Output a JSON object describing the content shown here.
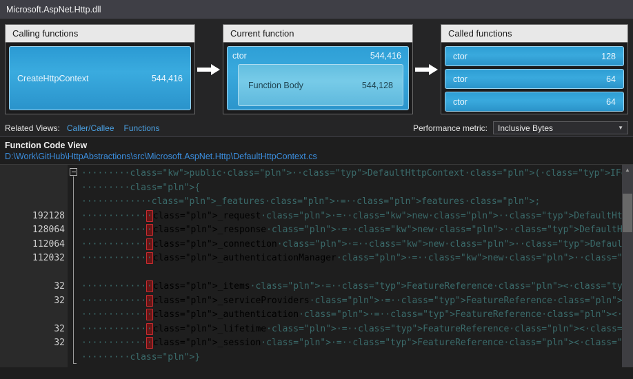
{
  "titlebar": {
    "text": "Microsoft.AspNet.Http.dll"
  },
  "callgraph": {
    "calling": {
      "header": "Calling functions",
      "items": [
        {
          "name": "CreateHttpContext",
          "value": "544,416"
        }
      ]
    },
    "current": {
      "header": "Current function",
      "name": "ctor",
      "value": "544,416",
      "body_name": "Function Body",
      "body_value": "544,128"
    },
    "called": {
      "header": "Called functions",
      "items": [
        {
          "name": "ctor",
          "value": "128"
        },
        {
          "name": "ctor",
          "value": "64"
        },
        {
          "name": "ctor",
          "value": "64"
        }
      ]
    }
  },
  "related_views": {
    "label": "Related Views:",
    "links": [
      "Caller/Callee",
      "Functions"
    ]
  },
  "performance_metric": {
    "label": "Performance metric:",
    "value": "Inclusive Bytes",
    "caret": "▼"
  },
  "function_code_view": {
    "title": "Function Code View",
    "path": "D:\\Work\\GitHub\\HttpAbstractions\\src\\Microsoft.AspNet.Http\\DefaultHttpContext.cs"
  },
  "code": {
    "gutter_counts": [
      "",
      "",
      "",
      "192128",
      "128064",
      "112064",
      "112032",
      "",
      "32",
      "32",
      "",
      "32",
      "32",
      ""
    ],
    "lines": [
      {
        "indent": 8,
        "text": "public DefaultHttpContext(IFeatureCollection features)",
        "highlight": false
      },
      {
        "indent": 8,
        "text": "{",
        "highlight": false
      },
      {
        "indent": 12,
        "text": "_features = features;",
        "highlight": false
      },
      {
        "indent": 12,
        "text": "_request = new DefaultHttpRequest(this, features);",
        "highlight": true
      },
      {
        "indent": 12,
        "text": "_response = new DefaultHttpResponse(this, features);",
        "highlight": true
      },
      {
        "indent": 12,
        "text": "_connection = new DefaultConnectionInfo(features);",
        "highlight": true
      },
      {
        "indent": 12,
        "text": "_authenticationManager = new DefaultAuthenticationManager(features);",
        "highlight": true
      },
      {
        "indent": 0,
        "text": "",
        "highlight": false
      },
      {
        "indent": 12,
        "text": "_items = FeatureReference<IItemsFeature>.Default;",
        "highlight": true
      },
      {
        "indent": 12,
        "text": "_serviceProviders = FeatureReference<IServiceProvidersFeature>.Default;",
        "highlight": true
      },
      {
        "indent": 12,
        "text": "_authentication = FeatureReference<IHttpAuthenticationFeature>.Default;",
        "highlight": true
      },
      {
        "indent": 12,
        "text": "_lifetime = FeatureReference<IHttpRequestLifetimeFeature>.Default;",
        "highlight": true
      },
      {
        "indent": 12,
        "text": "_session = FeatureReference<ISessionFeature>.Default;",
        "highlight": true
      },
      {
        "indent": 8,
        "text": "}",
        "highlight": false
      }
    ]
  },
  "colors": {
    "accent_blue": "#2e9ed4",
    "highlight_fill": "#661616",
    "highlight_border": "#c72c30",
    "link": "#3b8ede",
    "editor_bg": "#1e1e1e"
  }
}
